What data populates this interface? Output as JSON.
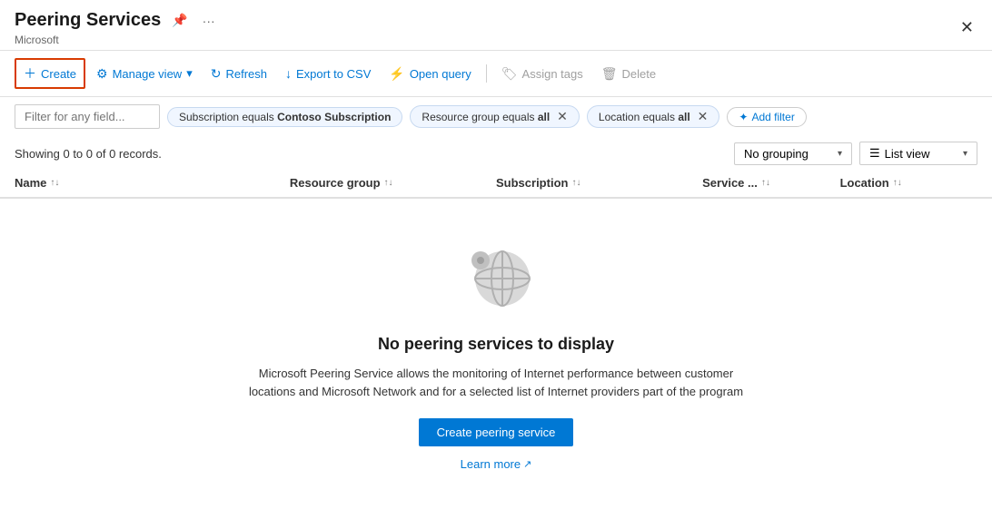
{
  "header": {
    "title": "Peering Services",
    "subtitle": "Microsoft",
    "pin_icon": "📌",
    "more_icon": "···",
    "close_icon": "✕"
  },
  "toolbar": {
    "create_label": "Create",
    "manage_view_label": "Manage view",
    "refresh_label": "Refresh",
    "export_label": "Export to CSV",
    "open_query_label": "Open query",
    "assign_tags_label": "Assign tags",
    "delete_label": "Delete"
  },
  "filters": {
    "placeholder": "Filter for any field...",
    "tags": [
      {
        "label": "Subscription equals ",
        "bold": "Contoso Subscription",
        "closable": false
      },
      {
        "label": "Resource group equals ",
        "bold": "all",
        "closable": true
      },
      {
        "label": "Location equals ",
        "bold": "all",
        "closable": true
      }
    ],
    "add_filter_label": "Add filter"
  },
  "info_bar": {
    "records_text": "Showing 0 to 0 of 0 records.",
    "grouping_label": "No grouping",
    "list_view_label": "List view"
  },
  "table": {
    "columns": [
      {
        "label": "Name",
        "sort": true
      },
      {
        "label": "Resource group",
        "sort": true
      },
      {
        "label": "Subscription",
        "sort": true
      },
      {
        "label": "Service ...",
        "sort": true
      },
      {
        "label": "Location",
        "sort": true
      }
    ]
  },
  "empty_state": {
    "title": "No peering services to display",
    "description_part1": "Microsoft Peering Service allows the monitoring of Internet performance between customer locations and Microsoft Network and for a selected list of Internet providers part of the program",
    "create_button": "Create peering service",
    "learn_more": "Learn more"
  }
}
